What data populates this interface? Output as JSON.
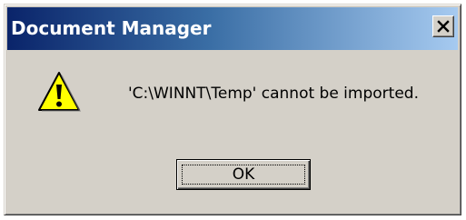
{
  "window": {
    "title": "Document Manager"
  },
  "titlebar": {
    "close_icon": "close-icon",
    "close_glyph": "X"
  },
  "message": {
    "icon": "warning-icon",
    "text": "'C:\\WINNT\\Temp' cannot be imported."
  },
  "buttons": {
    "ok_label": "OK"
  },
  "colors": {
    "titlebar_start": "#0a246a",
    "titlebar_end": "#a6caf0",
    "face": "#d4d0c8",
    "warning_yellow": "#ffff00"
  }
}
